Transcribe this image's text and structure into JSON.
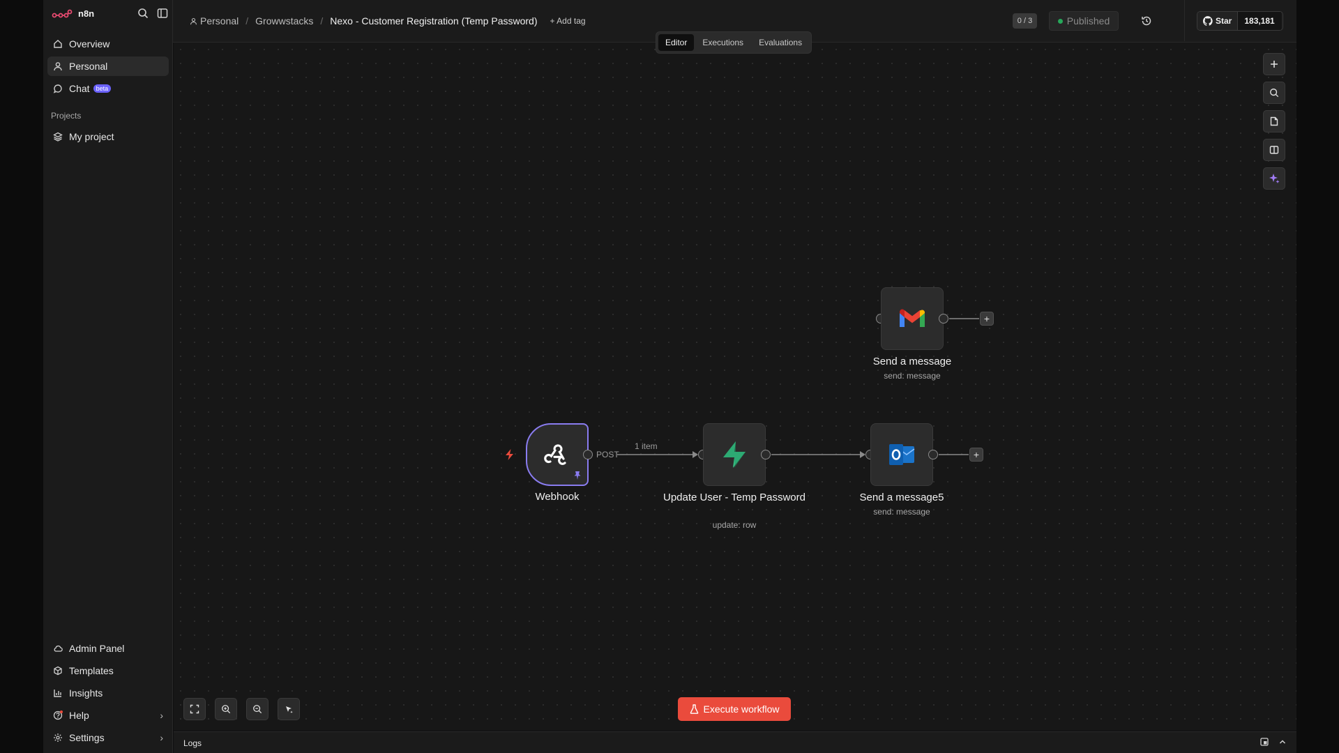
{
  "app": {
    "name": "n8n",
    "logo_color": "#ea4b71"
  },
  "sidebar": {
    "items": [
      {
        "label": "Overview",
        "icon": "home-icon"
      },
      {
        "label": "Personal",
        "icon": "user-icon",
        "active": true
      },
      {
        "label": "Chat",
        "icon": "chat-icon",
        "badge": "beta"
      }
    ],
    "projects_label": "Projects",
    "projects": [
      {
        "label": "My project",
        "icon": "layers-icon"
      }
    ],
    "bottom_items": [
      {
        "label": "Admin Panel",
        "icon": "cloud-icon"
      },
      {
        "label": "Templates",
        "icon": "box-icon"
      },
      {
        "label": "Insights",
        "icon": "chart-icon"
      },
      {
        "label": "Help",
        "icon": "help-icon",
        "chevron": true
      },
      {
        "label": "Settings",
        "icon": "gear-icon",
        "chevron": true
      }
    ]
  },
  "header": {
    "breadcrumbs": [
      "Personal",
      "Growwstacks",
      "Nexo - Customer Registration (Temp Password)"
    ],
    "add_tag": "+ Add tag",
    "counter": "0 / 3",
    "status": "Published",
    "github": {
      "star_label": "Star",
      "count": "183,181"
    }
  },
  "tabs": [
    "Editor",
    "Executions",
    "Evaluations"
  ],
  "active_tab": "Editor",
  "workflow": {
    "nodes": [
      {
        "id": "webhook",
        "title": "Webhook",
        "subtitle": "",
        "icon": "webhook-icon"
      },
      {
        "id": "update",
        "title": "Update User - Temp Password",
        "subtitle": "update: row",
        "icon": "supabase-icon"
      },
      {
        "id": "outlook",
        "title": "Send a message5",
        "subtitle": "send: message",
        "icon": "outlook-icon"
      },
      {
        "id": "gmail",
        "title": "Send a message",
        "subtitle": "send: message",
        "icon": "gmail-icon"
      }
    ],
    "edge_labels": {
      "webhook_output": "POST",
      "items": "1 item"
    }
  },
  "execute_button": "Execute workflow",
  "logs_label": "Logs",
  "colors": {
    "accent": "#ea4b3c",
    "trigger_border": "#8a7cf0",
    "published_dot": "#27a85a"
  }
}
